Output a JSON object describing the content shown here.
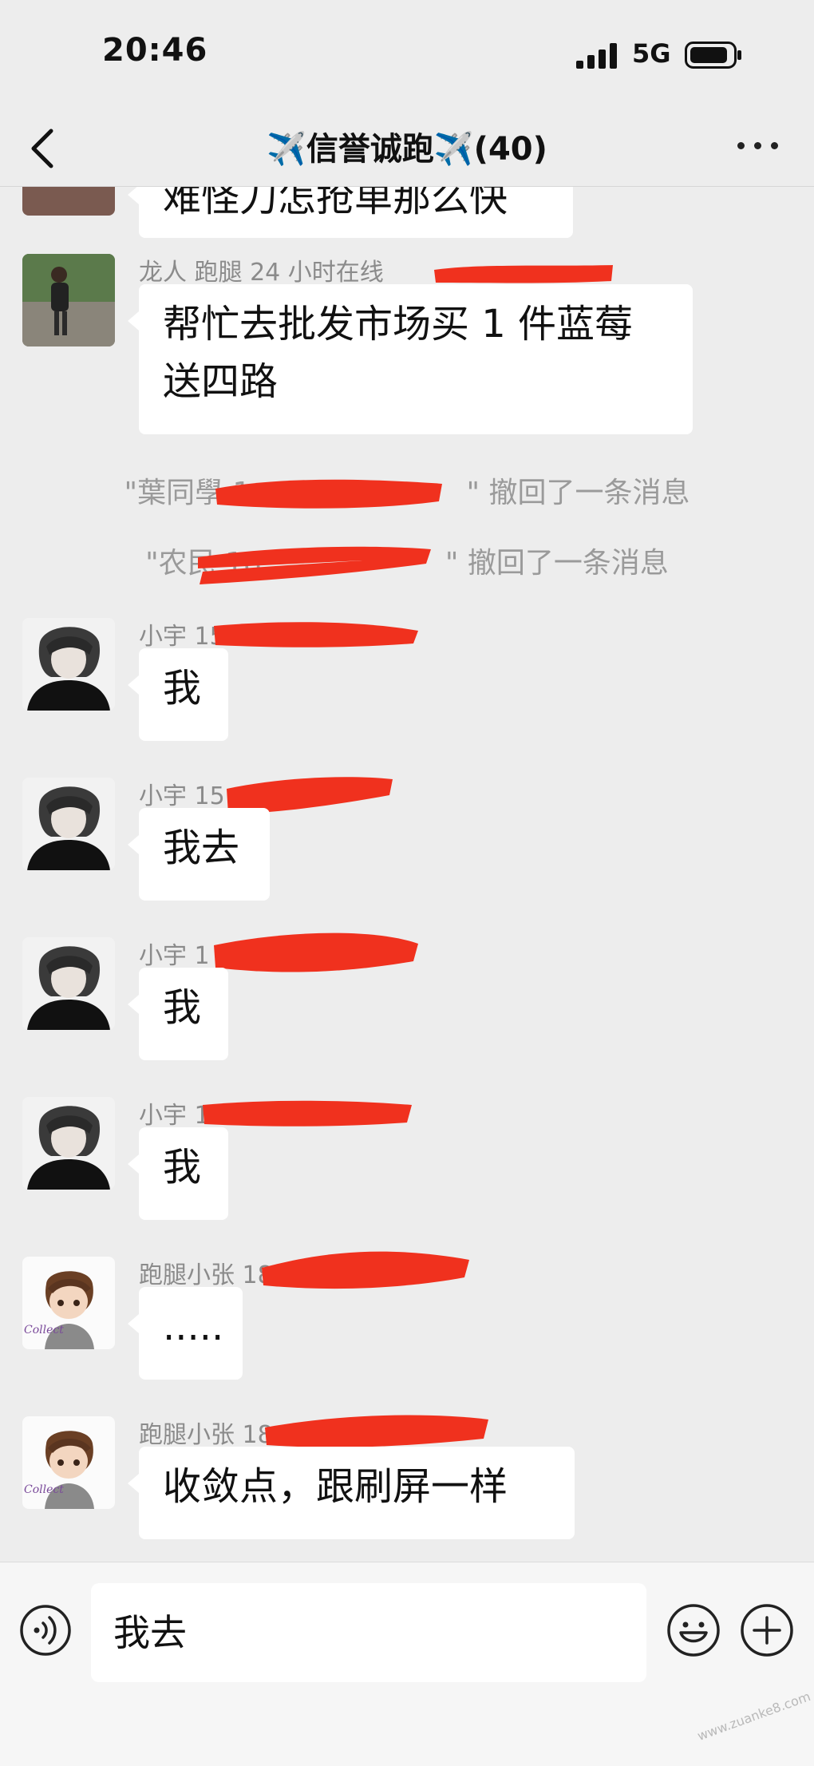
{
  "status": {
    "time": "20:46",
    "network": "5G"
  },
  "nav": {
    "title": "✈️信誉诚跑✈️(40)"
  },
  "messages": [
    {
      "sender": "",
      "text": "难怪刀怎抢单那么快"
    },
    {
      "sender": "龙人  跑腿 24 小时在线",
      "text": "帮忙去批发市场买 1 件蓝莓送四路"
    },
    {
      "sender": "小宇 15",
      "text": "我"
    },
    {
      "sender": "小宇 15",
      "text": "我去"
    },
    {
      "sender": "小宇 1",
      "text": "我"
    },
    {
      "sender": "小宇 15",
      "text": "我"
    },
    {
      "sender": "跑腿小张 18",
      "text": "....."
    },
    {
      "sender": "跑腿小张 18",
      "text": "收敛点，跟刷屏一样"
    }
  ],
  "system": [
    {
      "prefix": "\"葉同學 1",
      "suffix": "\" 撤回了一条消息"
    },
    {
      "prefix": "\"农民 18",
      "suffix": "\" 撤回了一条消息"
    }
  ],
  "input": {
    "value": "我去"
  },
  "icons": {
    "back": "chevron-left-icon",
    "more": "more-dots-icon",
    "voice": "voice-icon",
    "emoji": "emoji-icon",
    "plus": "plus-icon"
  },
  "watermark": "www.zuanke8.com"
}
